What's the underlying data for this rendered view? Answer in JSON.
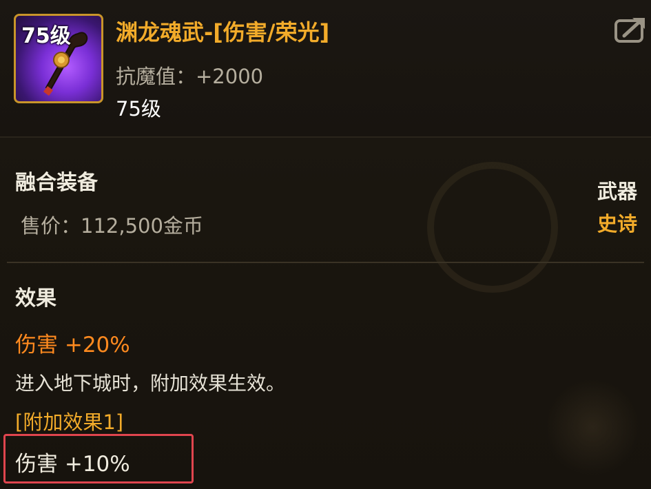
{
  "item": {
    "icon_level": "75级",
    "name": "渊龙魂武-[伤害/荣光]",
    "stat": "抗魔值：+2000",
    "level": "75级",
    "category": "融合装备",
    "price": "售价：112,500金币",
    "type": "武器",
    "rarity": "史诗"
  },
  "effects": {
    "title": "效果",
    "main": "伤害 +20%",
    "description": "进入地下城时，附加效果生效。",
    "sub_title": "[附加效果1]",
    "sub_effect": "伤害 +10%"
  },
  "icons": {
    "share": "share-icon",
    "weapon": "weapon-icon"
  },
  "colors": {
    "title": "#f2ab2a",
    "effect_main": "#ff8a1f",
    "highlight": "#e0454e",
    "icon_border": "#c9952a"
  }
}
